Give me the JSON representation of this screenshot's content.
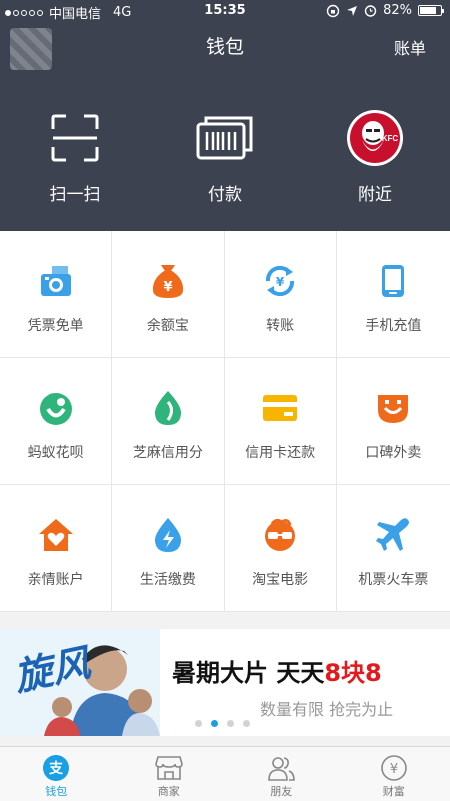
{
  "status": {
    "carrier": "中国电信",
    "network": "4G",
    "time": "15:35",
    "battery": "82%",
    "battery_level": 0.82
  },
  "nav": {
    "title": "钱包",
    "bill": "账单"
  },
  "top_actions": [
    {
      "label": "扫一扫",
      "icon": "scan-icon"
    },
    {
      "label": "付款",
      "icon": "barcode-icon"
    },
    {
      "label": "附近",
      "icon": "kfc-logo"
    }
  ],
  "grid": [
    {
      "label": "凭票免单",
      "icon": "ticket-camera-icon",
      "color": "#3aa0e8"
    },
    {
      "label": "余额宝",
      "icon": "money-bag-icon",
      "color": "#f06a1c"
    },
    {
      "label": "转账",
      "icon": "transfer-icon",
      "color": "#3aa0e8"
    },
    {
      "label": "手机充值",
      "icon": "phone-icon",
      "color": "#3aa0e8"
    },
    {
      "label": "蚂蚁花呗",
      "icon": "huabei-icon",
      "color": "#2fb57c"
    },
    {
      "label": "芝麻信用分",
      "icon": "sesame-icon",
      "color": "#2fb57c"
    },
    {
      "label": "信用卡还款",
      "icon": "credit-card-icon",
      "color": "#f7b500"
    },
    {
      "label": "口碑外卖",
      "icon": "takeout-icon",
      "color": "#f06a1c"
    },
    {
      "label": "亲情账户",
      "icon": "home-heart-icon",
      "color": "#f06a1c"
    },
    {
      "label": "生活缴费",
      "icon": "utility-drop-icon",
      "color": "#3aa0e8"
    },
    {
      "label": "淘宝电影",
      "icon": "movie-icon",
      "color": "#f06a1c"
    },
    {
      "label": "机票火车票",
      "icon": "plane-icon",
      "color": "#3aa0e8"
    }
  ],
  "banner": {
    "title_prefix": "暑期大片 天天",
    "title_highlight": "8块8",
    "subtitle": "数量有限 抢完为止",
    "art_text": "旋风",
    "page_count": 4,
    "active_page": 2
  },
  "tabs": [
    {
      "label": "钱包",
      "icon": "zhi-icon",
      "active": true
    },
    {
      "label": "商家",
      "icon": "store-icon",
      "active": false
    },
    {
      "label": "朋友",
      "icon": "friends-icon",
      "active": false
    },
    {
      "label": "财富",
      "icon": "yen-icon",
      "active": false
    }
  ]
}
